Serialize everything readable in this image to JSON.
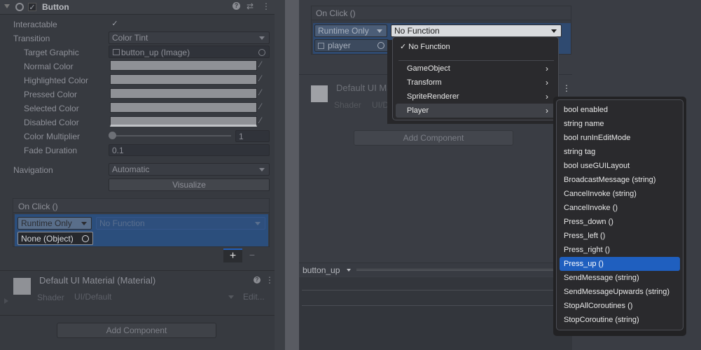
{
  "left": {
    "component_title": "Button",
    "fields": {
      "interactable_label": "Interactable",
      "transition_label": "Transition",
      "transition_value": "Color Tint",
      "target_graphic_label": "Target Graphic",
      "target_graphic_value": "button_up (Image)",
      "normal_color_label": "Normal Color",
      "highlighted_color_label": "Highlighted Color",
      "pressed_color_label": "Pressed Color",
      "selected_color_label": "Selected Color",
      "disabled_color_label": "Disabled Color",
      "color_multiplier_label": "Color Multiplier",
      "color_multiplier_value": "1",
      "color_multiplier_fraction": 0,
      "fade_duration_label": "Fade Duration",
      "fade_duration_value": "0.1",
      "navigation_label": "Navigation",
      "navigation_value": "Automatic",
      "visualize_label": "Visualize"
    },
    "onclick": {
      "header": "On Click ()",
      "runtime": "Runtime Only",
      "function": "No Function",
      "object": "None (Object)",
      "add": "+",
      "remove": "−"
    },
    "material": {
      "title": "Default UI Material (Material)",
      "shader_label": "Shader",
      "shader_value": "UI/Default",
      "edit_label": "Edit..."
    },
    "add_component": "Add Component"
  },
  "right": {
    "onclick": {
      "header": "On Click ()",
      "runtime": "Runtime Only",
      "function": "No Function",
      "object": "player"
    },
    "material": {
      "title": "Default UI Ma",
      "shader_label": "Shader",
      "shader_value": "UI/De"
    },
    "add_component": "Add Component",
    "preview_title": "button_up"
  },
  "menu": {
    "items": [
      "✓ No Function",
      "GameObject",
      "Transform",
      "SpriteRenderer",
      "Player"
    ]
  },
  "submenu": {
    "items": [
      "bool enabled",
      "string name",
      "bool runInEditMode",
      "string tag",
      "bool useGUILayout",
      "BroadcastMessage (string)",
      "CancelInvoke (string)",
      "CancelInvoke ()",
      "Press_down ()",
      "Press_left ()",
      "Press_right ()",
      "Press_up ()",
      "SendMessage (string)",
      "SendMessageUpwards (string)",
      "StopAllCoroutines ()",
      "StopCoroutine (string)"
    ]
  },
  "colors": {
    "accent": "#1f5fbf",
    "menu_bg": "#2a2a2d"
  },
  "icons": [
    "foldout-arrow-icon",
    "component-icon",
    "checkbox-icon",
    "help-icon",
    "presets-icon",
    "kebab-menu-icon",
    "eyedropper-icon",
    "object-picker-icon",
    "image-icon",
    "gameobject-icon",
    "chevron-right-icon",
    "dropdown-arrow-icon"
  ]
}
